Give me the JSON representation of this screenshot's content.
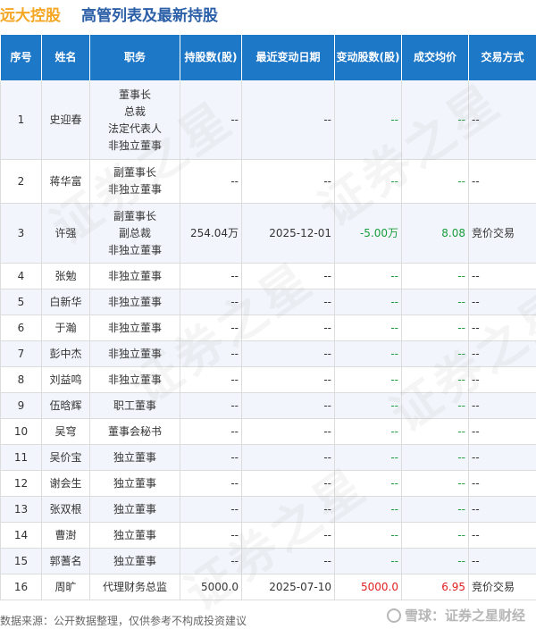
{
  "title": {
    "company": "远大控股",
    "text": "高管列表及最新持股"
  },
  "watermark": "证券之星",
  "headers": [
    "序号",
    "姓名",
    "职务",
    "持股数(股)",
    "最近变动日期",
    "变动股数(股)",
    "成交均价",
    "交易方式"
  ],
  "rows": [
    {
      "no": "1",
      "name": "史迎春",
      "roles": [
        "董事长",
        "总裁",
        "法定代表人",
        "非独立董事"
      ],
      "shares": "--",
      "date": "--",
      "change": "--",
      "price": "--",
      "method": "--"
    },
    {
      "no": "2",
      "name": "蒋华富",
      "roles": [
        "副董事长",
        "非独立董事"
      ],
      "shares": "--",
      "date": "--",
      "change": "--",
      "price": "--",
      "method": "--"
    },
    {
      "no": "3",
      "name": "许强",
      "roles": [
        "副董事长",
        "副总裁",
        "非独立董事"
      ],
      "shares": "254.04万",
      "date": "2025-12-01",
      "change": "-5.00万",
      "price": "8.08",
      "method": "竞价交易"
    },
    {
      "no": "4",
      "name": "张勉",
      "roles": [
        "非独立董事"
      ],
      "shares": "--",
      "date": "--",
      "change": "--",
      "price": "--",
      "method": "--"
    },
    {
      "no": "5",
      "name": "白新华",
      "roles": [
        "非独立董事"
      ],
      "shares": "--",
      "date": "--",
      "change": "--",
      "price": "--",
      "method": "--"
    },
    {
      "no": "6",
      "name": "于瀚",
      "roles": [
        "非独立董事"
      ],
      "shares": "--",
      "date": "--",
      "change": "--",
      "price": "--",
      "method": "--"
    },
    {
      "no": "7",
      "name": "彭中杰",
      "roles": [
        "非独立董事"
      ],
      "shares": "--",
      "date": "--",
      "change": "--",
      "price": "--",
      "method": "--"
    },
    {
      "no": "8",
      "name": "刘益鸣",
      "roles": [
        "非独立董事"
      ],
      "shares": "--",
      "date": "--",
      "change": "--",
      "price": "--",
      "method": "--"
    },
    {
      "no": "9",
      "name": "伍晗辉",
      "roles": [
        "职工董事"
      ],
      "shares": "--",
      "date": "--",
      "change": "--",
      "price": "--",
      "method": "--"
    },
    {
      "no": "10",
      "name": "吴穹",
      "roles": [
        "董事会秘书"
      ],
      "shares": "--",
      "date": "--",
      "change": "--",
      "price": "--",
      "method": "--"
    },
    {
      "no": "11",
      "name": "吴价宝",
      "roles": [
        "独立董事"
      ],
      "shares": "--",
      "date": "--",
      "change": "--",
      "price": "--",
      "method": "--"
    },
    {
      "no": "12",
      "name": "谢会生",
      "roles": [
        "独立董事"
      ],
      "shares": "--",
      "date": "--",
      "change": "--",
      "price": "--",
      "method": "--"
    },
    {
      "no": "13",
      "name": "张双根",
      "roles": [
        "独立董事"
      ],
      "shares": "--",
      "date": "--",
      "change": "--",
      "price": "--",
      "method": "--"
    },
    {
      "no": "14",
      "name": "曹澍",
      "roles": [
        "独立董事"
      ],
      "shares": "--",
      "date": "--",
      "change": "--",
      "price": "--",
      "method": "--"
    },
    {
      "no": "15",
      "name": "郭蓍名",
      "roles": [
        "独立董事"
      ],
      "shares": "--",
      "date": "--",
      "change": "--",
      "price": "--",
      "method": "--"
    },
    {
      "no": "16",
      "name": "周旷",
      "roles": [
        "代理财务总监"
      ],
      "shares": "5000.0",
      "date": "2025-07-10",
      "change": "5000.0",
      "price": "6.95",
      "method": "竞价交易"
    }
  ],
  "colors": {
    "header_bg": "#1e78c8",
    "company": "#f5a623",
    "title": "#2b5fa8",
    "negative": "#1a9c3c",
    "positive": "#e02020"
  },
  "footer": {
    "source": "数据来源：公开数据整理，仅供参考不构成投资建议"
  },
  "brand": {
    "text": "雪球：证券之星财经",
    "icon": "snowball-icon"
  }
}
